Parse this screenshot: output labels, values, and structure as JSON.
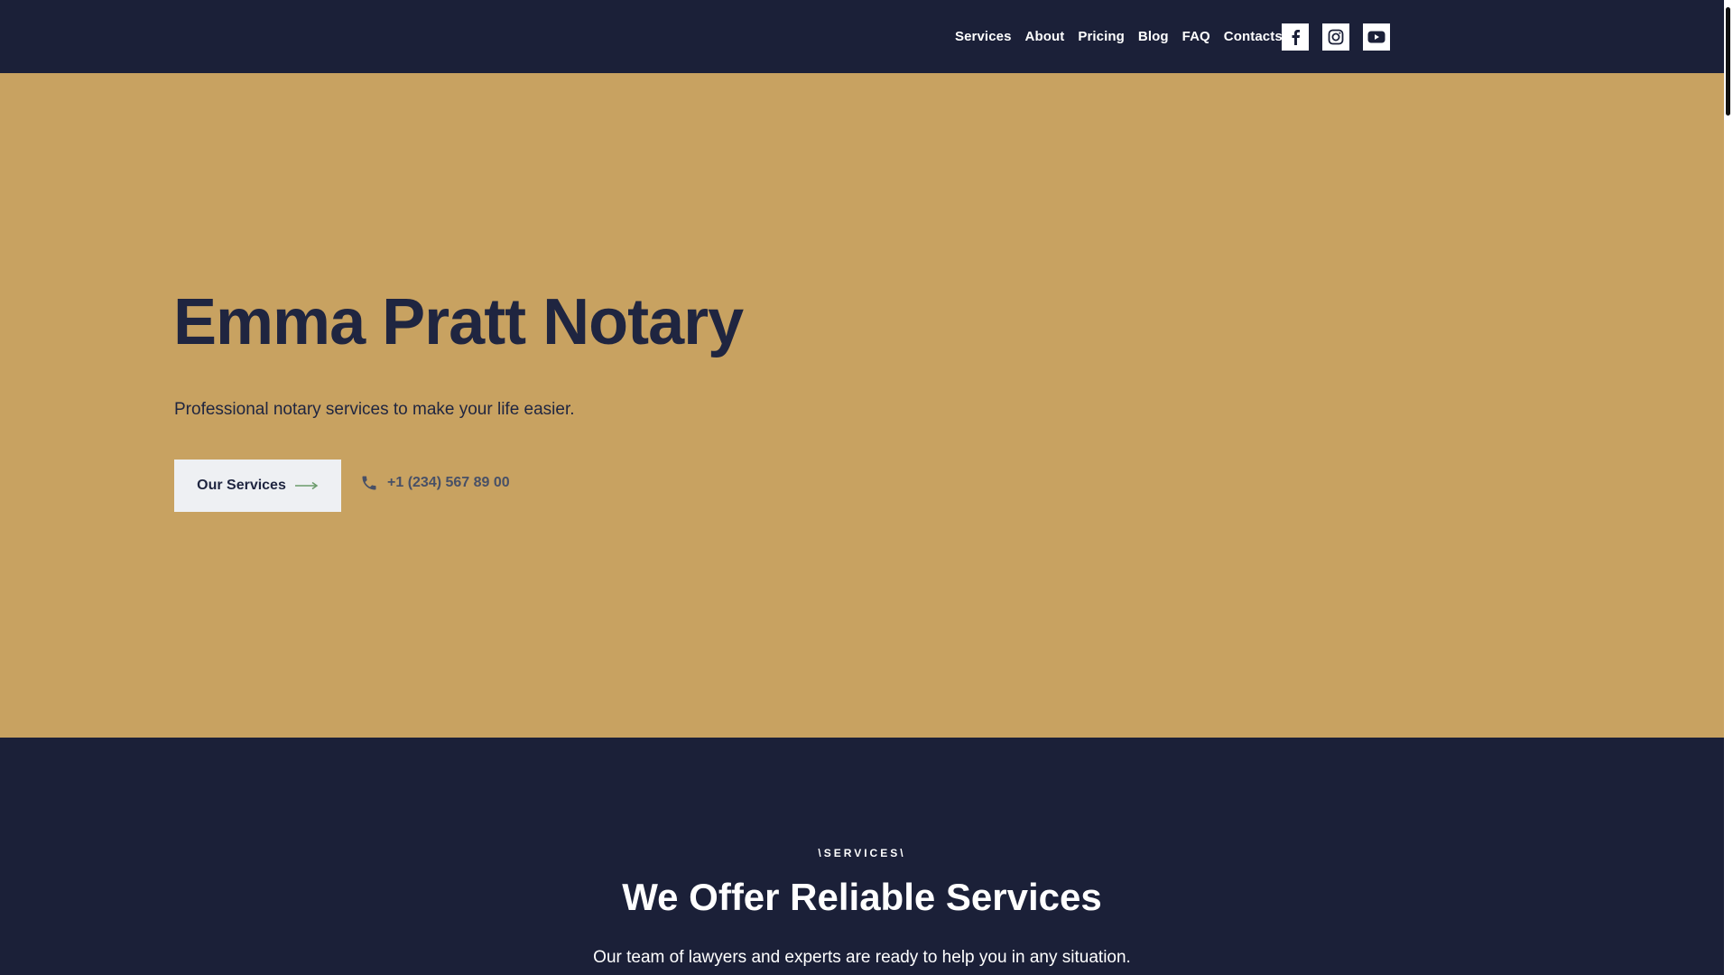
{
  "header": {
    "nav": [
      "Services",
      "About",
      "Pricing",
      "Blog",
      "FAQ",
      "Contacts"
    ],
    "socials": [
      "facebook-icon",
      "instagram-icon",
      "youtube-icon"
    ]
  },
  "hero": {
    "title": "Emma Pratt Notary",
    "subtitle": "Professional notary services to make your life easier.",
    "cta_label": "Our Services",
    "phone": "+1 (234) 567 89 00"
  },
  "services": {
    "eyebrow": "\\SERVICES\\",
    "title": "We Offer Reliable Services",
    "subtitle": "Our team of lawyers and experts are ready to help you in any situation."
  },
  "colors": {
    "header_bg": "#1b2038",
    "hero_bg": "#c8a261",
    "text_dark": "#1f2540",
    "button_bg": "#eef0f3",
    "arrow_green": "#6a9a6a"
  }
}
